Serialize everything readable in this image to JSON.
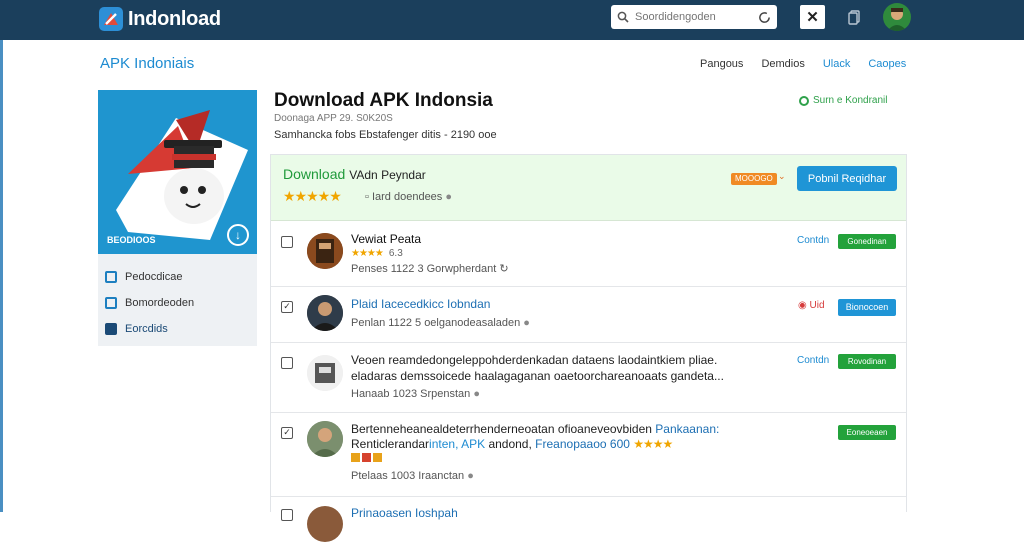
{
  "header": {
    "logo_text": "Indonload",
    "search_placeholder": "Soordidengoden",
    "close_label": "✕"
  },
  "site": {
    "name": "APK Indoniais",
    "nav": [
      "Pangous",
      "Demdios",
      "Ulack",
      "Caopes"
    ]
  },
  "hero": {
    "badge": "BEODIOOS"
  },
  "sidebar": {
    "items": [
      {
        "label": "Pedocdicae"
      },
      {
        "label": "Bomordeoden"
      },
      {
        "label": "Eorcdids"
      }
    ]
  },
  "main": {
    "title": "Download APK Indonsia",
    "subtitle": "Doonaga APP 29. S0K20S",
    "meta": "Samhancka fobs Ebstafenger ditis - 2190 ooe",
    "right_link": "Surn e Kondranil"
  },
  "featured": {
    "title": "Download",
    "title_suffix": "VAdn Peyndar",
    "stars": "★★★★★",
    "meta": "Iard doendees",
    "badge": "MOOOGO",
    "button": "Pobnil Reqidhar"
  },
  "rows": [
    {
      "title": "Vewiat Peata",
      "stars": "★★★★",
      "rating": "6.3",
      "meta": "Penses 1122 3 Gorwpherdant",
      "link": "Contdn",
      "pill": "Gonedinan"
    },
    {
      "title": "Plaid Iacecedkicc Iobndan",
      "meta": "Penlan 1122 5 oelganodeasaladen",
      "link": "Uid",
      "pill": "Bionocoen"
    },
    {
      "line1": "Veoen reamdedongeleppohderdenkadan dataens laodaintkiem pliae.",
      "line2": "eladaras demssoicede haalagaganan oaetoorchareanoaats gandeta...",
      "meta": "Hanaab 1023 Srpenstan",
      "link": "Contdn",
      "pill": "Rovodinan"
    },
    {
      "line1_a": "Bertenneheanealdeterrhenderneoatan ofioaneveovbiden",
      "line1_b": "Pankaanan:",
      "line2_a": "Renticlerandar",
      "line2_b": "inten, APK",
      "line2_c": "andond,",
      "line2_d": "Freanopaaoo 600",
      "line2_stars": "★★★★",
      "meta": "Ptelaas 1003 Iraanctan",
      "pill": "Eoneoeaen"
    },
    {
      "title": "Prinaoasen Ioshpah"
    }
  ]
}
